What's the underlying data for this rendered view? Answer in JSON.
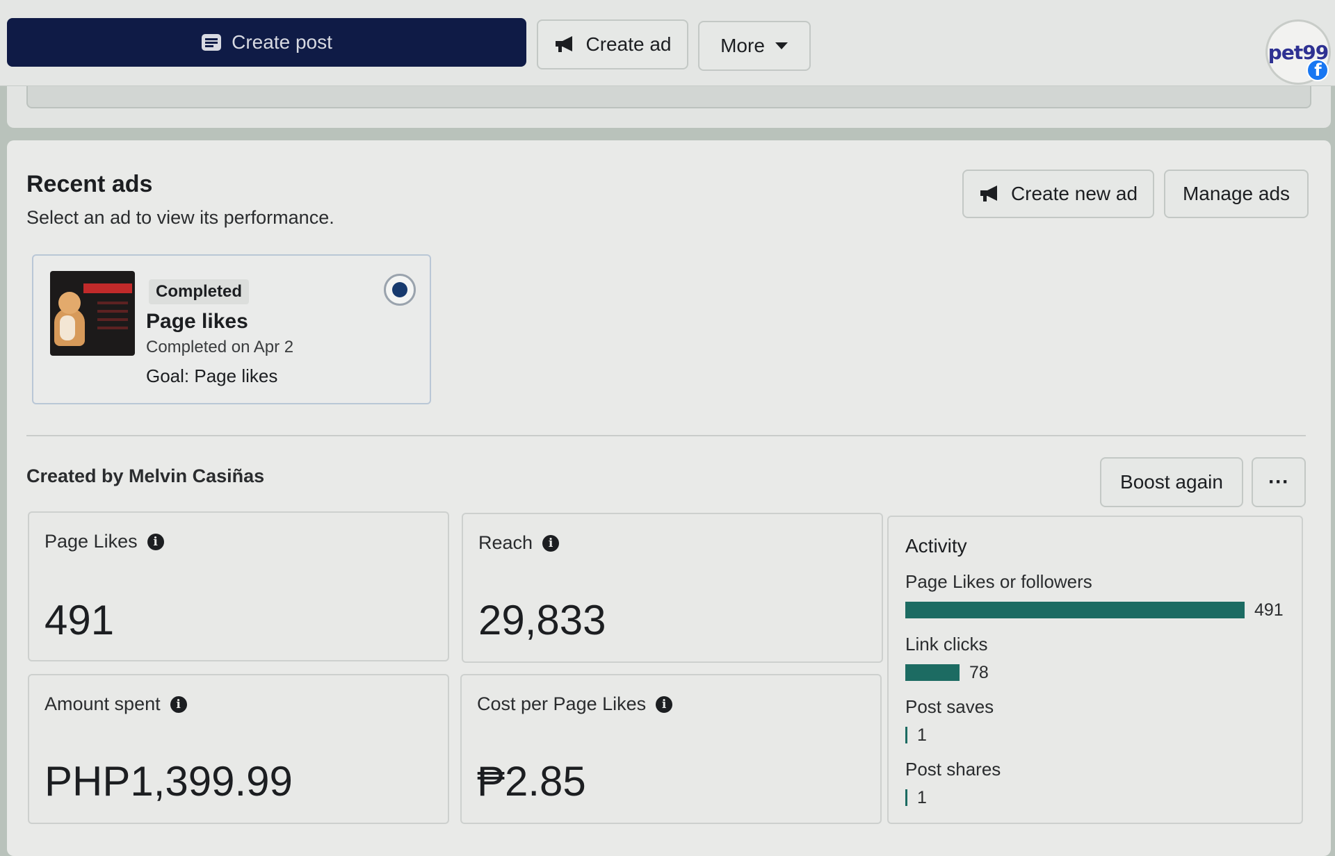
{
  "topbar": {
    "create_post_label": "Create post",
    "create_ad_label": "Create ad",
    "more_label": "More",
    "avatar_text": "pet99"
  },
  "recent_ads": {
    "title": "Recent ads",
    "subtitle": "Select an ad to view its performance.",
    "create_new_ad_label": "Create new ad",
    "manage_ads_label": "Manage ads",
    "ads": [
      {
        "status": "Completed",
        "name": "Page likes",
        "date": "Completed on Apr 2",
        "goal": "Goal: Page likes",
        "thumbnail_text": "PET ADVENTURE",
        "selected": true
      }
    ]
  },
  "details": {
    "created_by": "Created by Melvin Casiñas",
    "boost_again_label": "Boost again",
    "more_options_label": "···",
    "metrics": [
      {
        "label": "Page Likes",
        "value": "491"
      },
      {
        "label": "Reach",
        "value": "29,833"
      },
      {
        "label": "Amount spent",
        "value": "PHP1,399.99"
      },
      {
        "label": "Cost per Page Likes",
        "value": "₱2.85"
      }
    ],
    "activity": {
      "title": "Activity",
      "max": 491,
      "rows": [
        {
          "label": "Page Likes or followers",
          "value": 491
        },
        {
          "label": "Link clicks",
          "value": 78
        },
        {
          "label": "Post saves",
          "value": 1
        },
        {
          "label": "Post shares",
          "value": 1
        }
      ]
    }
  },
  "colors": {
    "create_post_bg": "#0f1b46",
    "activity_bar": "#1c6b62",
    "radio_selected": "#173a6e",
    "page_bg": "#e9eae8"
  }
}
